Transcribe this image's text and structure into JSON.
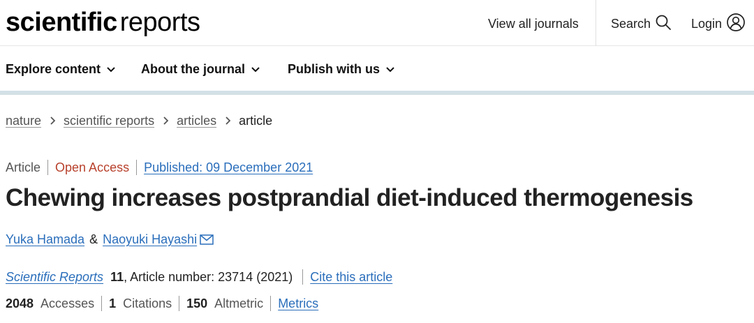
{
  "header": {
    "logo_bold": "scientific",
    "logo_light": "reports",
    "view_all": "View all journals",
    "search": "Search",
    "login": "Login"
  },
  "nav": {
    "explore": "Explore content",
    "about": "About the journal",
    "publish": "Publish with us"
  },
  "breadcrumb": {
    "items": [
      "nature",
      "scientific reports",
      "articles"
    ],
    "current": "article"
  },
  "article": {
    "type": "Article",
    "access": "Open Access",
    "published": "Published: 09 December 2021",
    "title": "Chewing increases postprandial diet-induced thermogenesis",
    "authors": [
      "Yuka Hamada",
      "Naoyuki Hayashi"
    ],
    "author_sep": "&",
    "journal": "Scientific Reports",
    "volume": "11",
    "article_number": ", Article number: 23714 (2021)",
    "cite": "Cite this article"
  },
  "metrics": {
    "accesses_value": "2048",
    "accesses_label": "Accesses",
    "citations_value": "1",
    "citations_label": "Citations",
    "altmetric_value": "150",
    "altmetric_label": "Altmetric",
    "metrics_link": "Metrics"
  },
  "colors": {
    "link": "#2a6ebb",
    "open_access": "#b8412c",
    "nav_rule": "#d3e0e6"
  }
}
